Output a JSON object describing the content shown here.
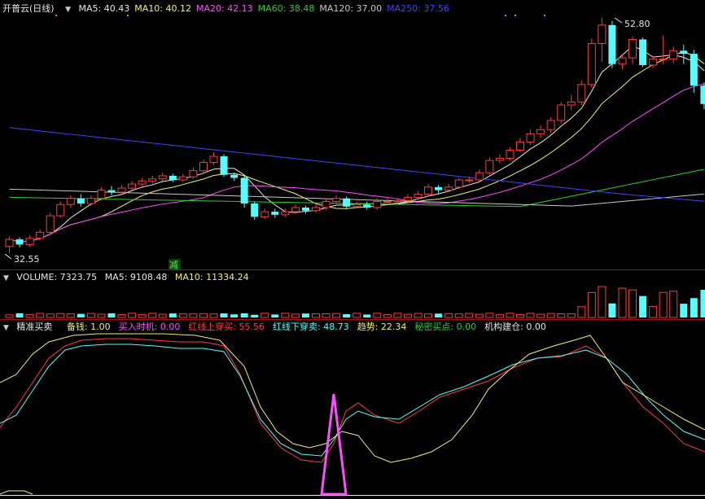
{
  "colors": {
    "bg": "#000000",
    "up": "#ff3b3b",
    "down": "#54ffff",
    "ma5": "#e8e8e8",
    "ma10": "#f5f06a",
    "ma20": "#ff4cff",
    "ma60": "#2ad12a",
    "ma120": "#c8c8c8",
    "ma250": "#3b46ff",
    "divider": "#a01010"
  },
  "price_panel": {
    "title": "开普云(日线)",
    "ma": [
      {
        "label": "MA5: 40.43",
        "color": "#e8e8e8"
      },
      {
        "label": "MA10: 40.12",
        "color": "#f5f06a"
      },
      {
        "label": "MA20: 42.13",
        "color": "#ff4cff"
      },
      {
        "label": "MA60: 38.48",
        "color": "#2ad12a"
      },
      {
        "label": "MA120: 37.00",
        "color": "#c8c8c8"
      },
      {
        "label": "MA250: 37.56",
        "color": "#3b46ff"
      }
    ],
    "high_label": "52.80",
    "low_label": "32.55",
    "event_tag": "减"
  },
  "volume_panel": {
    "title": "VOLUME: 7323.75",
    "ma5": "MA5: 9108.48",
    "ma10": "MA10: 11334.24"
  },
  "indicator_panel": {
    "title": "精准买卖",
    "items": [
      {
        "label": "备钱: 1.00",
        "color": "#f5f06a"
      },
      {
        "label": "买入时机: 0.00",
        "color": "#ff4cff"
      },
      {
        "label": "红线上穿买: 55.56",
        "color": "#ff3b3b"
      },
      {
        "label": "红线下穿卖: 48.73",
        "color": "#54ffff"
      },
      {
        "label": "趋势: 22.34",
        "color": "#f5f06a"
      },
      {
        "label": "秘密买点: 0.00",
        "color": "#2ad12a"
      },
      {
        "label": "机构建仓: 0.00",
        "color": "#e8e8e8"
      }
    ]
  },
  "chart_data": {
    "type": "candlestick",
    "high": 52.8,
    "low": 32.55,
    "candles": [
      [
        33.2,
        33.9,
        32.55,
        34.2
      ],
      [
        33.9,
        33.4,
        33.1,
        34.1
      ],
      [
        33.4,
        34.0,
        33.2,
        34.3
      ],
      [
        34.0,
        34.6,
        33.8,
        34.9
      ],
      [
        34.6,
        36.2,
        34.4,
        36.5
      ],
      [
        36.2,
        37.3,
        36.0,
        37.6
      ],
      [
        37.3,
        37.9,
        37.0,
        38.2
      ],
      [
        37.9,
        37.4,
        37.1,
        38.3
      ],
      [
        37.4,
        37.9,
        37.2,
        38.2
      ],
      [
        37.9,
        38.7,
        37.7,
        39.0
      ],
      [
        38.7,
        38.5,
        38.2,
        39.1
      ],
      [
        38.5,
        38.9,
        38.2,
        39.2
      ],
      [
        38.9,
        39.3,
        38.7,
        39.6
      ],
      [
        39.3,
        39.6,
        39.1,
        39.9
      ],
      [
        39.6,
        39.8,
        39.3,
        40.1
      ],
      [
        39.8,
        40.1,
        39.6,
        40.4
      ],
      [
        40.1,
        39.7,
        39.5,
        40.3
      ],
      [
        39.7,
        40.0,
        39.5,
        40.3
      ],
      [
        40.0,
        40.6,
        39.8,
        40.9
      ],
      [
        40.6,
        41.4,
        40.4,
        41.7
      ],
      [
        41.4,
        42.0,
        41.2,
        42.4
      ],
      [
        42.0,
        40.2,
        40.0,
        42.2
      ],
      [
        40.2,
        39.9,
        39.6,
        40.4
      ],
      [
        39.9,
        37.4,
        37.0,
        40.1
      ],
      [
        37.4,
        36.1,
        35.8,
        37.6
      ],
      [
        36.1,
        36.6,
        35.9,
        36.9
      ],
      [
        36.6,
        36.3,
        36.0,
        36.9
      ],
      [
        36.3,
        36.6,
        36.1,
        36.9
      ],
      [
        36.6,
        37.0,
        36.4,
        37.3
      ],
      [
        37.0,
        36.7,
        36.4,
        37.2
      ],
      [
        36.7,
        37.0,
        36.5,
        37.3
      ],
      [
        37.0,
        37.6,
        36.8,
        37.9
      ],
      [
        37.6,
        37.9,
        37.4,
        38.2
      ],
      [
        37.9,
        37.1,
        36.9,
        38.1
      ],
      [
        37.1,
        37.3,
        36.9,
        37.6
      ],
      [
        37.3,
        37.0,
        36.8,
        37.6
      ],
      [
        37.0,
        37.6,
        36.8,
        37.9
      ],
      [
        37.6,
        37.6,
        37.3,
        37.9
      ],
      [
        37.6,
        37.7,
        37.4,
        37.9
      ],
      [
        37.7,
        38.0,
        37.5,
        38.3
      ],
      [
        38.0,
        38.3,
        37.8,
        38.6
      ],
      [
        38.3,
        39.0,
        38.1,
        39.3
      ],
      [
        39.0,
        38.7,
        38.4,
        39.2
      ],
      [
        38.7,
        39.0,
        38.5,
        39.3
      ],
      [
        39.0,
        39.7,
        38.8,
        39.9
      ],
      [
        39.7,
        39.7,
        39.4,
        40.0
      ],
      [
        39.7,
        40.4,
        39.5,
        40.7
      ],
      [
        40.4,
        41.6,
        40.2,
        41.9
      ],
      [
        41.6,
        41.8,
        41.3,
        42.2
      ],
      [
        41.8,
        42.6,
        41.6,
        42.9
      ],
      [
        42.6,
        43.4,
        42.4,
        43.8
      ],
      [
        43.4,
        44.2,
        43.1,
        44.6
      ],
      [
        44.2,
        44.6,
        43.8,
        45.0
      ],
      [
        44.6,
        45.5,
        44.3,
        45.8
      ],
      [
        45.5,
        47.0,
        45.2,
        47.3
      ],
      [
        47.0,
        47.3,
        46.5,
        48.0
      ],
      [
        47.3,
        49.0,
        47.0,
        49.4
      ],
      [
        49.0,
        53.0,
        48.7,
        53.5
      ],
      [
        53.0,
        54.8,
        51.2,
        55.5
      ],
      [
        54.8,
        51.0,
        50.6,
        55.2
      ],
      [
        51.0,
        51.6,
        50.5,
        51.9
      ],
      [
        51.6,
        53.4,
        51.0,
        53.7
      ],
      [
        53.4,
        50.9,
        50.7,
        53.6
      ],
      [
        50.9,
        51.5,
        50.6,
        51.8
      ],
      [
        51.5,
        51.5,
        51.0,
        53.8
      ],
      [
        51.5,
        52.3,
        51.1,
        52.7
      ],
      [
        52.3,
        52.0,
        51.0,
        52.9
      ],
      [
        52.0,
        48.9,
        48.2,
        52.4
      ],
      [
        48.9,
        47.1,
        46.6,
        49.2
      ]
    ]
  }
}
